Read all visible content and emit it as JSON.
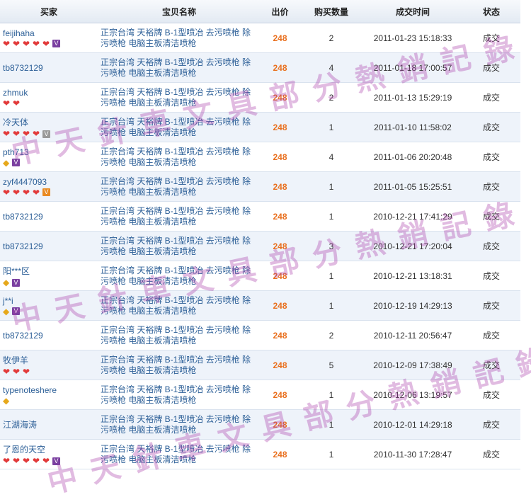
{
  "columns": [
    "买家",
    "宝贝名称",
    "出价",
    "购买数量",
    "成交时间",
    "状态"
  ],
  "item_name": "正宗台湾 天裕牌 B-1型喷冶 去污喷枪 除污喷枪 电脑主板清洁喷枪",
  "rows": [
    {
      "buyer": "feijihaha",
      "badges": [
        "heart",
        "heart",
        "heart",
        "heart",
        "heart",
        "vip"
      ],
      "price": "248",
      "qty": "2",
      "time": "2011-01-23 15:18:33",
      "status": "成交"
    },
    {
      "buyer": "tb8732129",
      "badges": [],
      "price": "248",
      "qty": "4",
      "time": "2011-01-18 17:00:57",
      "status": "成交"
    },
    {
      "buyer": "zhmuk",
      "badges": [
        "heart",
        "heart"
      ],
      "price": "248",
      "qty": "2",
      "time": "2011-01-13 15:29:19",
      "status": "成交"
    },
    {
      "buyer": "冷天体",
      "badges": [
        "heart",
        "heart",
        "heart",
        "heart",
        "vipgrey"
      ],
      "price": "248",
      "qty": "1",
      "time": "2011-01-10 11:58:02",
      "status": "成交"
    },
    {
      "buyer": "pth713",
      "badges": [
        "diamond",
        "vip"
      ],
      "price": "248",
      "qty": "4",
      "time": "2011-01-06 20:20:48",
      "status": "成交"
    },
    {
      "buyer": "zyf4447093",
      "badges": [
        "heart",
        "heart",
        "heart",
        "heart",
        "viporange"
      ],
      "price": "248",
      "qty": "1",
      "time": "2011-01-05 15:25:51",
      "status": "成交"
    },
    {
      "buyer": "tb8732129",
      "badges": [],
      "price": "248",
      "qty": "1",
      "time": "2010-12-21 17:41:29",
      "status": "成交"
    },
    {
      "buyer": "tb8732129",
      "badges": [],
      "price": "248",
      "qty": "3",
      "time": "2010-12-21 17:20:04",
      "status": "成交"
    },
    {
      "buyer": "阳***区",
      "badges": [
        "diamond",
        "vip"
      ],
      "price": "248",
      "qty": "1",
      "time": "2010-12-21 13:18:31",
      "status": "成交"
    },
    {
      "buyer": "j**i",
      "badges": [
        "diamond",
        "vip"
      ],
      "price": "248",
      "qty": "1",
      "time": "2010-12-19 14:29:13",
      "status": "成交"
    },
    {
      "buyer": "tb8732129",
      "badges": [],
      "price": "248",
      "qty": "2",
      "time": "2010-12-11 20:56:47",
      "status": "成交"
    },
    {
      "buyer": "牧伊羊",
      "badges": [
        "heart",
        "heart",
        "heart"
      ],
      "price": "248",
      "qty": "5",
      "time": "2010-12-09 17:38:49",
      "status": "成交"
    },
    {
      "buyer": "typenoteshere",
      "badges": [
        "diamond"
      ],
      "price": "248",
      "qty": "1",
      "time": "2010-12-06 13:19:57",
      "status": "成交"
    },
    {
      "buyer": "江湖海涛",
      "badges": [],
      "price": "248",
      "qty": "1",
      "time": "2010-12-01 14:29:18",
      "status": "成交"
    },
    {
      "buyer": "了恩的天空",
      "badges": [
        "heart",
        "heart",
        "heart",
        "heart",
        "heart",
        "vip"
      ],
      "price": "248",
      "qty": "1",
      "time": "2010-11-30 17:28:47",
      "status": "成交"
    }
  ],
  "watermark": "中天針車文具部分熱銷記錄"
}
